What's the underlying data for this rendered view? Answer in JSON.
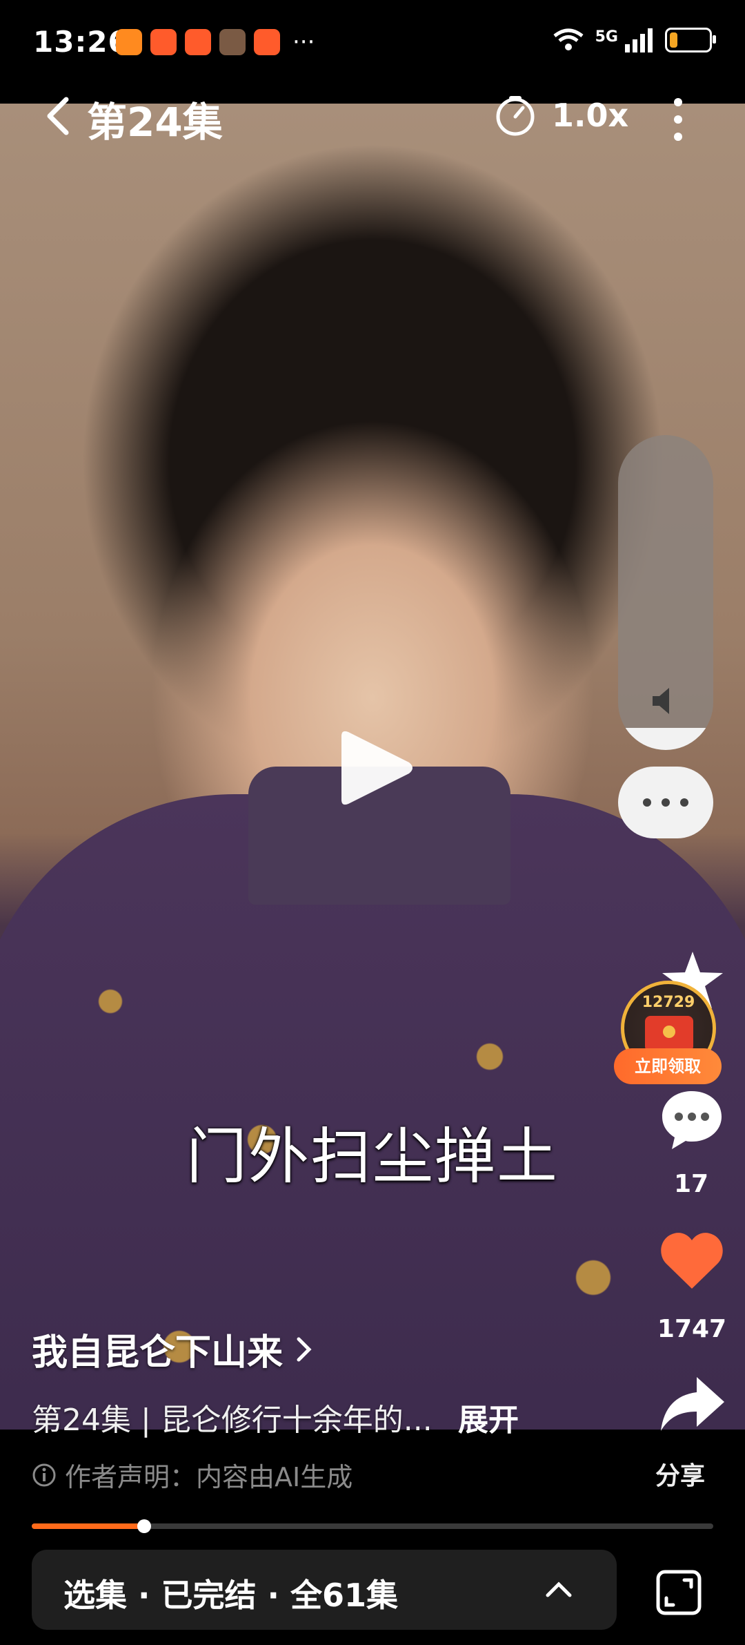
{
  "status_bar": {
    "time": "13:26",
    "network": "5G",
    "battery_percent": 20,
    "notification_icons": [
      "heart-app-icon",
      "video-app-icon",
      "video-app-icon",
      "game-app-icon",
      "video-app-icon"
    ],
    "overflow": "···"
  },
  "header": {
    "episode_title": "第24集",
    "speed_label": "1.0x"
  },
  "player": {
    "subtitle": "门外扫尘掸土",
    "volume_level": 0.07,
    "progress": 0.165
  },
  "actions": {
    "reward_count": "12729",
    "reward_claim": "立即领取",
    "comment_count": "17",
    "like_count": "1747",
    "share_label": "分享"
  },
  "info": {
    "series_title": "我自昆仑下山来",
    "description": "第24集 | 昆仑修行十余年的...",
    "expand_label": "展开",
    "disclaimer": "作者声明：内容由AI生成"
  },
  "episode_bar": {
    "label": "选集 · 已完结 · 全61集"
  },
  "colors": {
    "accent": "#ff6a1a",
    "like": "#ff6a3a",
    "reward_border": "#f0b23a"
  }
}
